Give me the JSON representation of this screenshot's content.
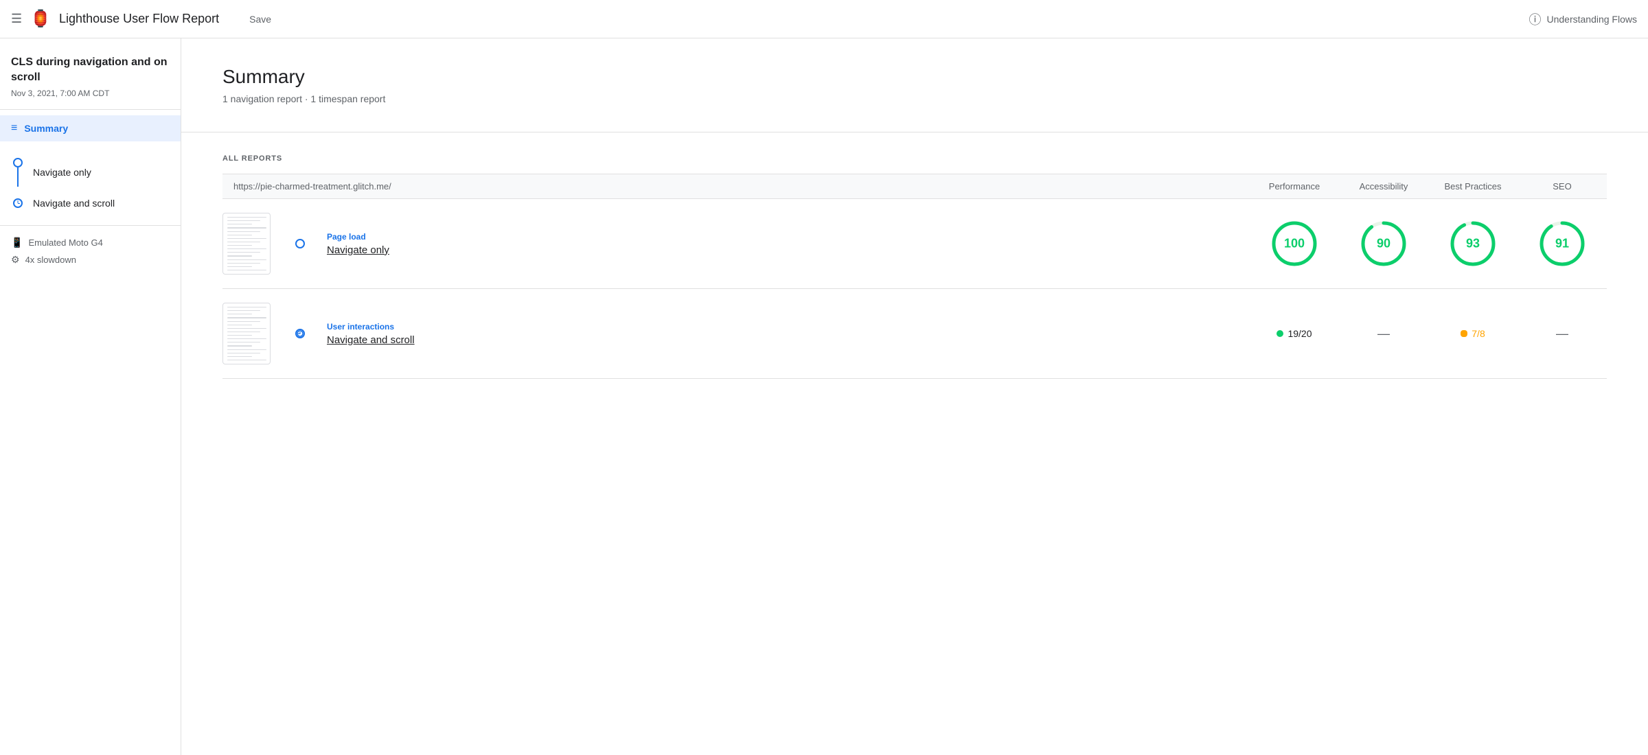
{
  "header": {
    "menu_icon": "☰",
    "logo": "🏮",
    "title": "Lighthouse User Flow Report",
    "save_label": "Save",
    "help_icon": "?",
    "understanding_flows": "Understanding Flows"
  },
  "sidebar": {
    "report_title": "CLS during navigation and on scroll",
    "report_date": "Nov 3, 2021, 7:00 AM CDT",
    "summary_label": "Summary",
    "nav_items": [
      {
        "label": "Navigate only",
        "type": "circle"
      },
      {
        "label": "Navigate and scroll",
        "type": "clock"
      }
    ],
    "device": {
      "emulation": "Emulated Moto G4",
      "slowdown": "4x slowdown"
    }
  },
  "main": {
    "summary": {
      "title": "Summary",
      "subtitle": "1 navigation report · 1 timespan report"
    },
    "reports": {
      "section_label": "ALL REPORTS",
      "columns": {
        "url": "https://pie-charmed-treatment.glitch.me/",
        "performance": "Performance",
        "accessibility": "Accessibility",
        "best_practices": "Best Practices",
        "seo": "SEO"
      },
      "rows": [
        {
          "type": "Page load",
          "name": "Navigate only",
          "flow_icon": "circle",
          "performance": {
            "value": 100,
            "type": "circle"
          },
          "accessibility": {
            "value": 90,
            "type": "circle"
          },
          "best_practices": {
            "value": 93,
            "type": "circle"
          },
          "seo": {
            "value": 91,
            "type": "circle"
          }
        },
        {
          "type": "User interactions",
          "name": "Navigate and scroll",
          "flow_icon": "clock",
          "performance": {
            "value": "19/20",
            "type": "timespan_green"
          },
          "accessibility": {
            "value": "—",
            "type": "dash"
          },
          "best_practices": {
            "value": "7/8",
            "type": "timespan_orange"
          },
          "seo": {
            "value": "—",
            "type": "dash"
          }
        }
      ]
    }
  }
}
